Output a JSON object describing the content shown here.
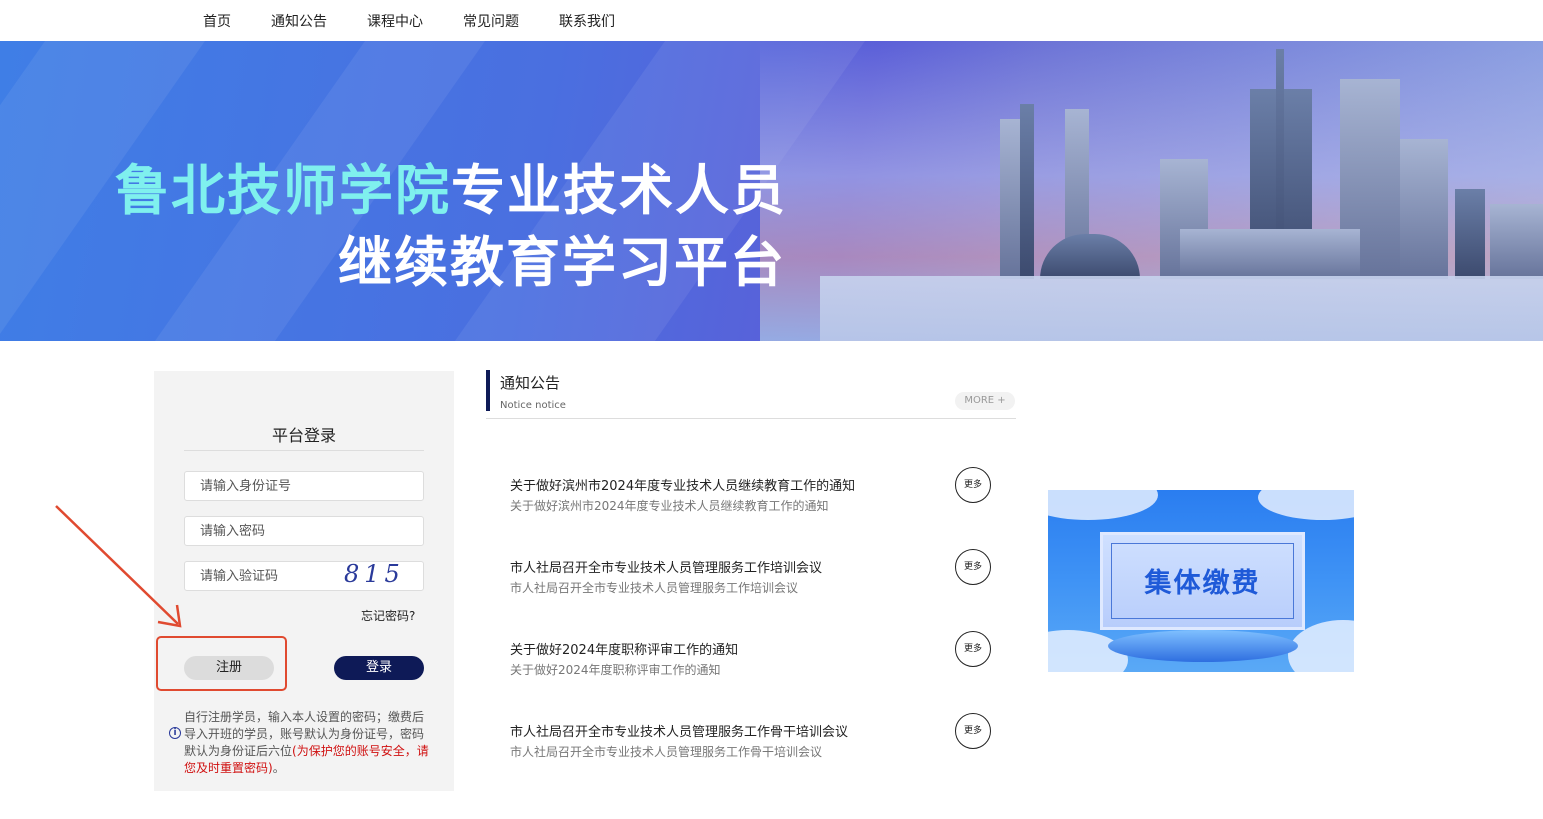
{
  "nav": {
    "items": [
      "首页",
      "通知公告",
      "课程中心",
      "常见问题",
      "联系我们"
    ]
  },
  "banner": {
    "title_highlight": "鲁北技师学院",
    "title_rest": "专业技术人员",
    "title_line2": "继续教育学习平台"
  },
  "login": {
    "title": "平台登录",
    "id_placeholder": "请输入身份证号",
    "password_placeholder": "请输入密码",
    "captcha_placeholder": "请输入验证码",
    "captcha_value": "815",
    "forgot": "忘记密码?",
    "register_label": "注册",
    "login_label": "登录",
    "note_normal": "自行注册学员，输入本人设置的密码；缴费后导入开班的学员，账号默认为身份证号，密码默认为身份证后六位",
    "note_red": "(为保护您的账号安全，请您及时重置密码)",
    "note_end": "。",
    "info_icon": "i"
  },
  "notices": {
    "title": "通知公告",
    "subtitle": "Notice notice",
    "more": "MORE +",
    "items": [
      {
        "title": "关于做好滨州市2024年度专业技术人员继续教育工作的通知",
        "summary": "关于做好滨州市2024年度专业技术人员继续教育工作的通知",
        "more": "更多"
      },
      {
        "title": "市人社局召开全市专业技术人员管理服务工作培训会议",
        "summary": "市人社局召开全市专业技术人员管理服务工作培训会议",
        "more": "更多"
      },
      {
        "title": "关于做好2024年度职称评审工作的通知",
        "summary": "关于做好2024年度职称评审工作的通知",
        "more": "更多"
      },
      {
        "title": "市人社局召开全市专业技术人员管理服务工作骨干培训会议",
        "summary": "市人社局召开全市专业技术人员管理服务工作骨干培训会议",
        "more": "更多"
      }
    ]
  },
  "ad": {
    "label": "集体缴费"
  },
  "colors": {
    "navy": "#0e1a57",
    "annotation": "#e04a30",
    "highlight_title": "#7ff0ee",
    "warning_red": "#d01010"
  }
}
